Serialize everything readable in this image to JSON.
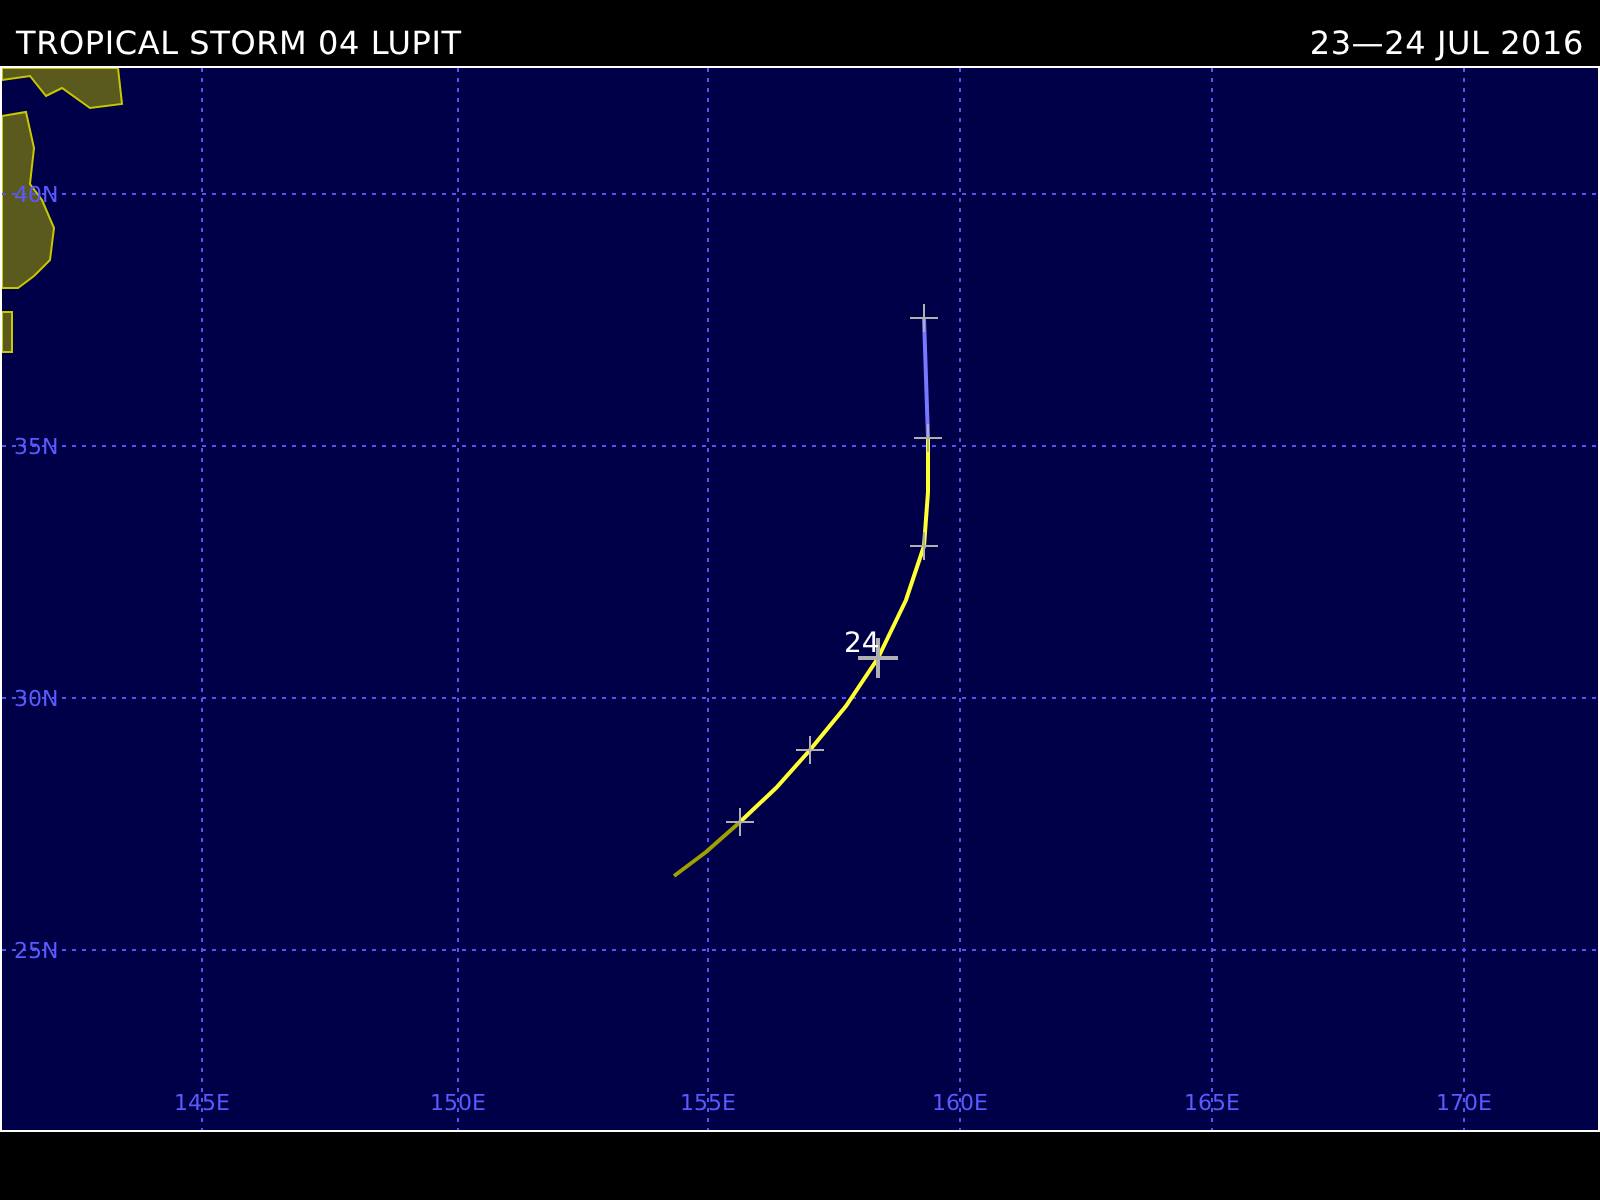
{
  "header": {
    "title": "TROPICAL STORM 04 LUPIT",
    "date": "23—24 JUL 2016"
  },
  "map": {
    "latitude_labels": [
      "40N",
      "35N",
      "30N",
      "25N"
    ],
    "longitude_labels": [
      "145E",
      "150E",
      "155E",
      "160E",
      "165E",
      "170E"
    ],
    "track_segments": [
      {
        "color": "#a0a000"
      },
      {
        "color": "#ffff33"
      },
      {
        "color": "#7777ff"
      }
    ],
    "day_label": "24"
  }
}
